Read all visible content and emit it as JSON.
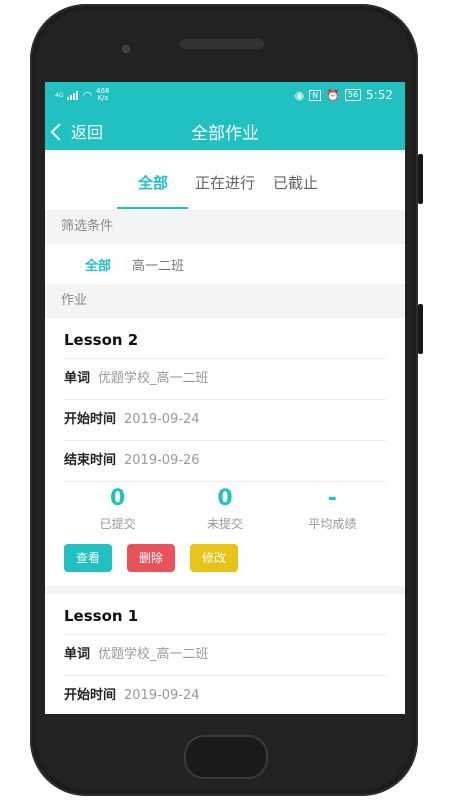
{
  "status_bar": {
    "network": "4G",
    "speed_value": "468",
    "speed_unit": "K/s",
    "battery": "56",
    "time": "5:52"
  },
  "nav": {
    "back_label": "返回",
    "title": "全部作业"
  },
  "tabs": [
    {
      "label": "全部",
      "active": true
    },
    {
      "label": "正在进行",
      "active": false
    },
    {
      "label": "已截止",
      "active": false
    }
  ],
  "filter_section_label": "筛选条件",
  "filters": [
    {
      "label": "全部",
      "active": true
    },
    {
      "label": "高一二班",
      "active": false
    }
  ],
  "homework_section_label": "作业",
  "homework": [
    {
      "title": "Lesson 2",
      "type_label": "单词",
      "type_value": "优题学校_高一二班",
      "start_label": "开始时间",
      "start_value": "2019-09-24",
      "end_label": "结束时间",
      "end_value": "2019-09-26",
      "submitted_value": "0",
      "submitted_label": "已提交",
      "unsubmitted_value": "0",
      "unsubmitted_label": "未提交",
      "avg_value": "-",
      "avg_label": "平均成绩",
      "view_label": "查看",
      "delete_label": "删除",
      "edit_label": "修改"
    },
    {
      "title": "Lesson 1",
      "type_label": "单词",
      "type_value": "优题学校_高一二班",
      "start_label": "开始时间",
      "start_value": "2019-09-24"
    }
  ],
  "colors": {
    "accent": "#22c1c1",
    "delete": "#e8525a",
    "edit": "#e8c418"
  }
}
